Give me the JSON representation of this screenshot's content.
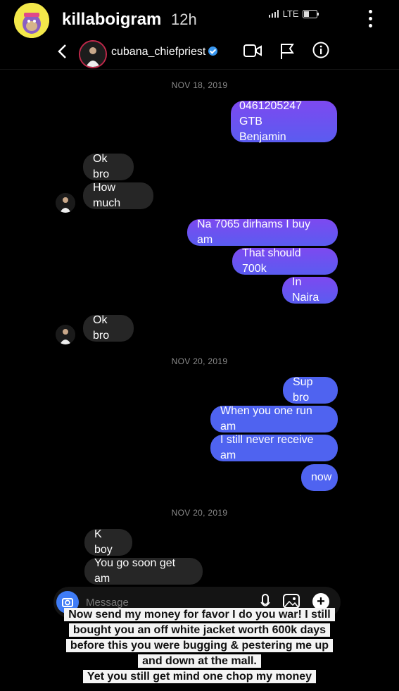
{
  "story": {
    "username": "killaboigram",
    "time": "12h",
    "network": "LTE"
  },
  "dm_header": {
    "username": "cubana_chiefpriest"
  },
  "messages": [
    {
      "date": "NOV 18, 2019"
    },
    {
      "text": "0461205247 GTB\nBenjamin",
      "from": "me"
    },
    {
      "text": "Ok bro",
      "from": "them"
    },
    {
      "text": "How much",
      "from": "them"
    },
    {
      "text": "Na 7065 dirhams I buy am",
      "from": "me"
    },
    {
      "text": "That should 700k",
      "from": "me"
    },
    {
      "text": "In Naira",
      "from": "me"
    },
    {
      "text": "Ok bro",
      "from": "them"
    },
    {
      "date": "NOV 20, 2019"
    },
    {
      "text": "Sup bro",
      "from": "me"
    },
    {
      "text": "When you one run am",
      "from": "me"
    },
    {
      "text": "I still never receive am",
      "from": "me"
    },
    {
      "text": "now",
      "from": "me"
    },
    {
      "date": "NOV 20, 2019"
    },
    {
      "text": "K boy",
      "from": "them"
    },
    {
      "text": "You go soon get am",
      "from": "them"
    }
  ],
  "composer": {
    "placeholder": "Message"
  },
  "caption": {
    "lines": [
      "Now send my money for favor I do you war! I still",
      "bought you an off white jacket worth 600k days",
      "before this you were bugging & pestering me up",
      "and down at the mall.",
      "Yet you still get mind one chop my money"
    ]
  },
  "colors": {
    "outgoing_bubble": "#6a53f0",
    "incoming_bubble": "#262626",
    "verified_badge": "#3897f0",
    "camera_button": "#3f7cf6"
  }
}
